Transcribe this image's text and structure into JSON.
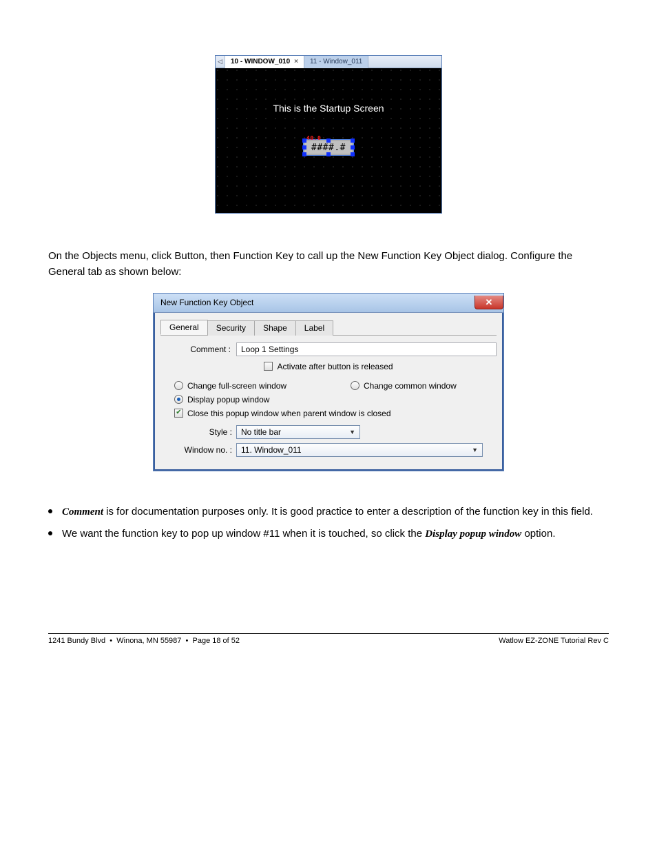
{
  "editor": {
    "tab_active": "10 - WINDOW_010",
    "tab_close_glyph": "×",
    "tab_inactive": "11 - Window_011",
    "scroll_glyph": "◁",
    "canvas_text": "This is the Startup Screen",
    "numeric_placeholder": "####.#",
    "numeric_note": "40.0"
  },
  "para1": "On the Objects menu, click Button, then Function Key to call up the New Function Key Object dialog. Configure the General tab as shown below:",
  "dialog": {
    "title": "New  Function Key Object",
    "tabs": [
      "General",
      "Security",
      "Shape",
      "Label"
    ],
    "comment_label": "Comment :",
    "comment_value": "Loop 1 Settings",
    "activate_label": "Activate after button is released",
    "opt_fullscreen": "Change full-screen window",
    "opt_common": "Change common window",
    "opt_popup": "Display popup window",
    "opt_closeparent": "Close this popup window when parent window is closed",
    "style_label": "Style :",
    "style_value": "No title bar",
    "windowno_label": "Window no. :",
    "windowno_value": "11. Window_011"
  },
  "bullets": {
    "b1a": "Comment",
    "b1b": " is for documentation purposes only. It is good practice to enter a description of the function key in this field.",
    "b2a": "We want the function key to pop up window #11 when it is touched, so click the ",
    "b2b": "Display popup window",
    "b2c": " option."
  },
  "footer": {
    "left": "1241 Bundy Blvd",
    "mid": "Winona, MN 55987",
    "page_label": "Page ",
    "page_no": "18",
    "page_of": " of 52",
    "right": "Watlow EZ-ZONE Tutorial Rev C"
  }
}
